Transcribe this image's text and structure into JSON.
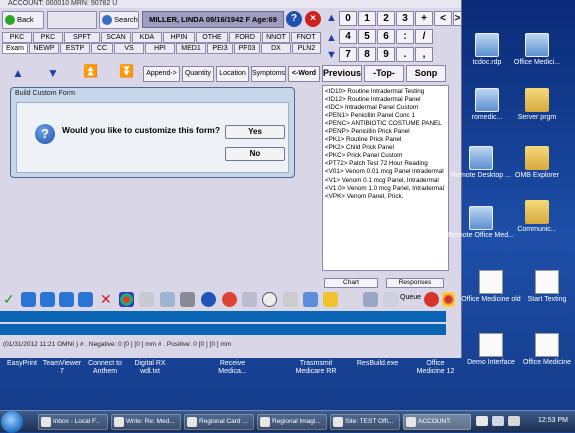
{
  "app": {
    "topbar_text": "ACCOUNT: 000010   MRN: 90782  U",
    "back_label": "Back",
    "search_label": "Search",
    "patient_info": "MILLER, LINDA 09/16/1942 F Age:69",
    "help_glyph": "?",
    "close_glyph": "×",
    "keypad": [
      "0",
      "1",
      "2",
      "3",
      "+",
      "<",
      ">",
      "4",
      "5",
      "6",
      ":",
      "/",
      "7",
      "8",
      "9",
      ".",
      ","
    ],
    "tabs_row1": [
      "PKC",
      "PKC",
      "SPFT",
      "SCAN",
      "KDA",
      "HPIN",
      "OTHE",
      "FORD",
      "NNOT",
      "FNOT"
    ],
    "tabs_row2": [
      "Exam",
      "NEWP",
      "ESTP",
      "CC",
      "VS",
      "HPI",
      "MED1",
      "PEI3",
      "PF03",
      "DX",
      "PLN2"
    ],
    "tool_buttons": {
      "append": "Append->",
      "quantity": "Quantity",
      "location": "Location",
      "symptoms": "Symptoms",
      "word": "<-Word",
      "previous": "Previous",
      "top": "-Top-",
      "sonp": "Sonp"
    },
    "code_list": [
      "<ID10> Routine Intradermal Testing",
      "<ID12> Routine Intradermal Panel",
      "<IDC> Intradermal Panel Custom",
      "<PEN1> Penicillin Panel Conc 1",
      "<PENC> ANTIBIOTIC COSTUME PANEL",
      "<PENP> Penicillin Prick Panel",
      "<PK1> Routine Prick Panel",
      "<PK2> Child Prick Panel",
      "<PKC> Prick Panel Custom",
      "<PT72> Patch Test 72 Hour Reading",
      "<V01> Venom 0.01 mcg Panel intradermal",
      "<V1> Venom 0.1 mcg Panel, Intradermal",
      "<V1.0> Venom 1.0 mcg Panel, Intradermal",
      "<VPK> Venom Panel, Prick."
    ],
    "chart_btn": "Chart",
    "responses_btn": "Responses",
    "queue_label": "Queue",
    "status_text": "(01/31/2012 11:21 OMNI ) # . Negative: 0 [0 ] [0 ] mm # . Positive: 0 [0 ] [0 ] mm"
  },
  "dialog": {
    "title": "Build Custom Form",
    "icon_glyph": "?",
    "question": "Would you like to customize this form?",
    "yes": "Yes",
    "no": "No"
  },
  "desktop_icons": [
    "tcdoc.rdp",
    "Office Medici...",
    "romedic...",
    "Server prgm",
    "Remote Desktop ...",
    "OMB Explorer",
    "Remote Office Med...",
    "Communic...",
    "Office Medicine old",
    "Start Texting",
    "Demo Interface",
    "Office Medicine"
  ],
  "strip_labels": [
    "EasyPrint",
    "TeamViewer 7",
    "Connect to Anthem",
    "Digital RX wdl.txt",
    "Receive Medica...",
    "Trasmsmit Medicare RR",
    "ResBuild.exe",
    "Office Medicine 12"
  ],
  "taskbar": {
    "items": [
      "Inbox - Local F...",
      "Write: Re: Med...",
      "Regional Card ...",
      "Regional Imagi...",
      "Site: TEST Offi...",
      "ACCOUNT:"
    ],
    "clock": "12:53 PM"
  }
}
